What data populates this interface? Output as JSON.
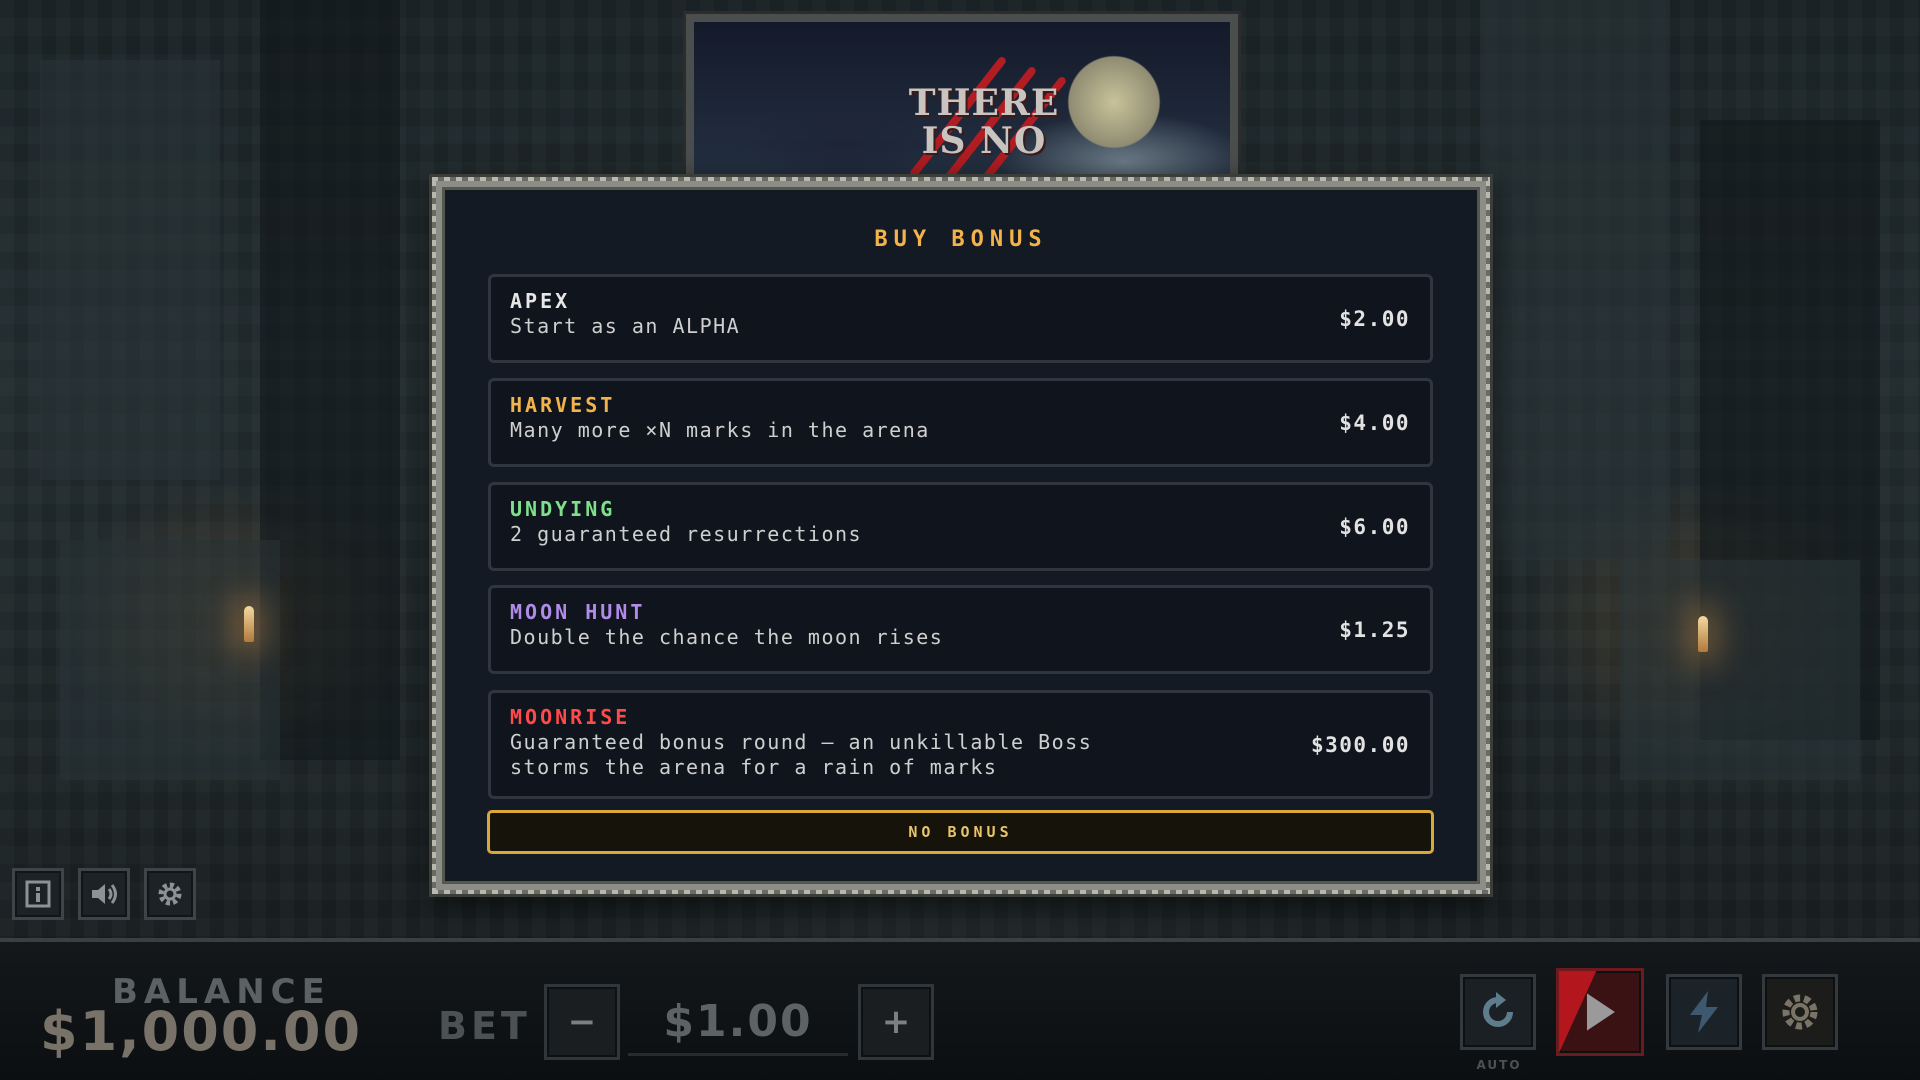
{
  "banner": {
    "title": "THERE IS NO",
    "moon": "moon"
  },
  "modal": {
    "title": "BUY BONUS",
    "options": [
      {
        "name": "APEX",
        "description": "Start as an ALPHA",
        "price": "$2.00",
        "color": "#e6e6e6"
      },
      {
        "name": "HARVEST",
        "description": "Many more ×N marks in the arena",
        "price": "$4.00",
        "color": "#f2b44a"
      },
      {
        "name": "UNDYING",
        "description": "2 guaranteed resurrections",
        "price": "$6.00",
        "color": "#7ee08a"
      },
      {
        "name": "MOON HUNT",
        "description": "Double the chance the moon rises",
        "price": "$1.25",
        "color": "#b08be8"
      },
      {
        "name": "MOONRISE",
        "description": "Guaranteed bonus round — an unkillable Boss\nstorms the arena for a rain of marks",
        "price": "$300.00",
        "color": "#ff4a4a"
      }
    ],
    "no_bonus_label": "NO BONUS"
  },
  "mini_controls": [
    {
      "icon": "info-icon"
    },
    {
      "icon": "sound-icon"
    },
    {
      "icon": "gear-icon"
    }
  ],
  "bottom_bar": {
    "balance_label": "BALANCE",
    "balance_value": "$1,000.00",
    "bet_label": "BET",
    "bet_value": "$1.00",
    "minus_label": "−",
    "plus_label": "+",
    "auto_label": "AUTO",
    "controls": [
      {
        "icon": "autoplay-icon"
      },
      {
        "icon": "play-icon",
        "color": "#b3161c"
      },
      {
        "icon": "lightning-icon"
      },
      {
        "icon": "settings-icon"
      }
    ]
  }
}
